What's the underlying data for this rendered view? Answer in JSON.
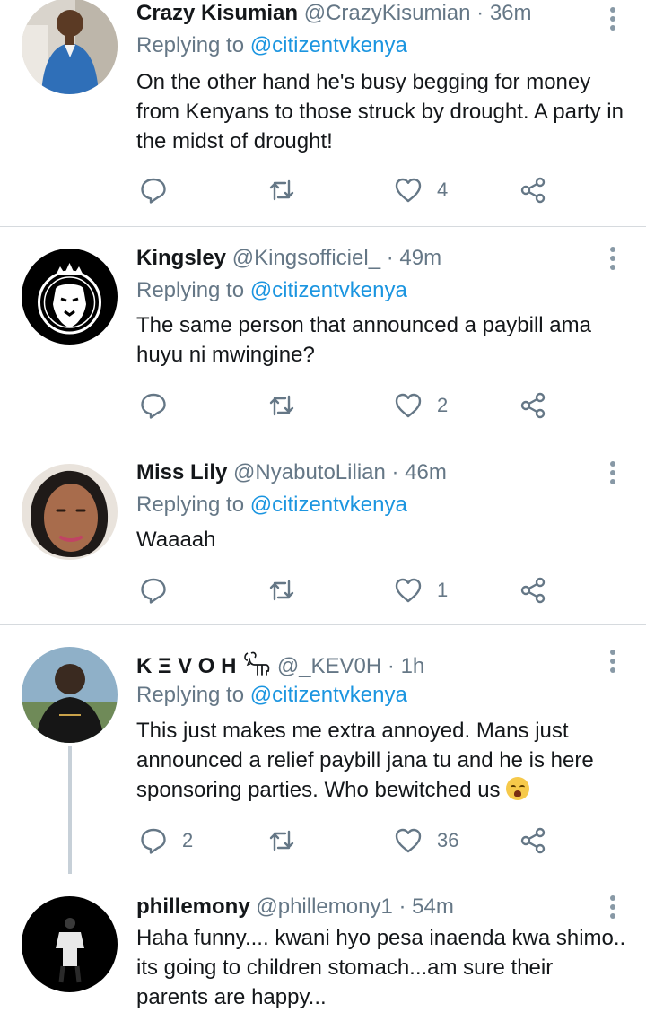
{
  "colors": {
    "link": "#1b95e0",
    "secondary": "#657786",
    "icon": "#657786",
    "divider": "#d6dade"
  },
  "icons": {
    "reply": "reply-icon",
    "retweet": "retweet-icon",
    "like": "heart-icon",
    "share": "share-icon",
    "more": "more-vertical-icon"
  },
  "tweets": [
    {
      "name": "Crazy Kisumian",
      "handle": "@CrazyKisumian",
      "time": "· 36m",
      "replying_prefix": "Replying to ",
      "replying_to": "@citizentvkenya",
      "text": "On the other hand he's busy begging for money from Kenyans to those struck by drought. A party in the midst of drought!",
      "replies": "",
      "retweets": "",
      "likes": "4"
    },
    {
      "name": "Kingsley",
      "handle": "@Kingsofficiel_",
      "time": "· 49m",
      "replying_prefix": "Replying to ",
      "replying_to": "@citizentvkenya",
      "text": "The same person that announced a paybill ama huyu ni mwingine?",
      "replies": "",
      "retweets": "",
      "likes": "2"
    },
    {
      "name": "Miss Lily",
      "handle": "@NyabutoLilian",
      "time": "· 46m",
      "replying_prefix": "Replying to ",
      "replying_to": "@citizentvkenya",
      "text": "Waaaah",
      "replies": "",
      "retweets": "",
      "likes": "1"
    },
    {
      "name": "K Ξ V O H",
      "handle": "@_KEV0H",
      "time": "· 1h",
      "replying_prefix": "Replying to ",
      "replying_to": "@citizentvkenya",
      "text": "This just makes me extra annoyed. Mans just announced a relief paybill jana tu and he is here sponsoring parties. Who bewitched us",
      "replies": "2",
      "retweets": "",
      "likes": "36"
    },
    {
      "name": "phillemony",
      "handle": "@phillemony1",
      "time": "· 54m",
      "text": "Haha funny.... kwani hyo pesa inaenda kwa shimo.. its going to children stomach...am sure their parents are happy..."
    }
  ]
}
